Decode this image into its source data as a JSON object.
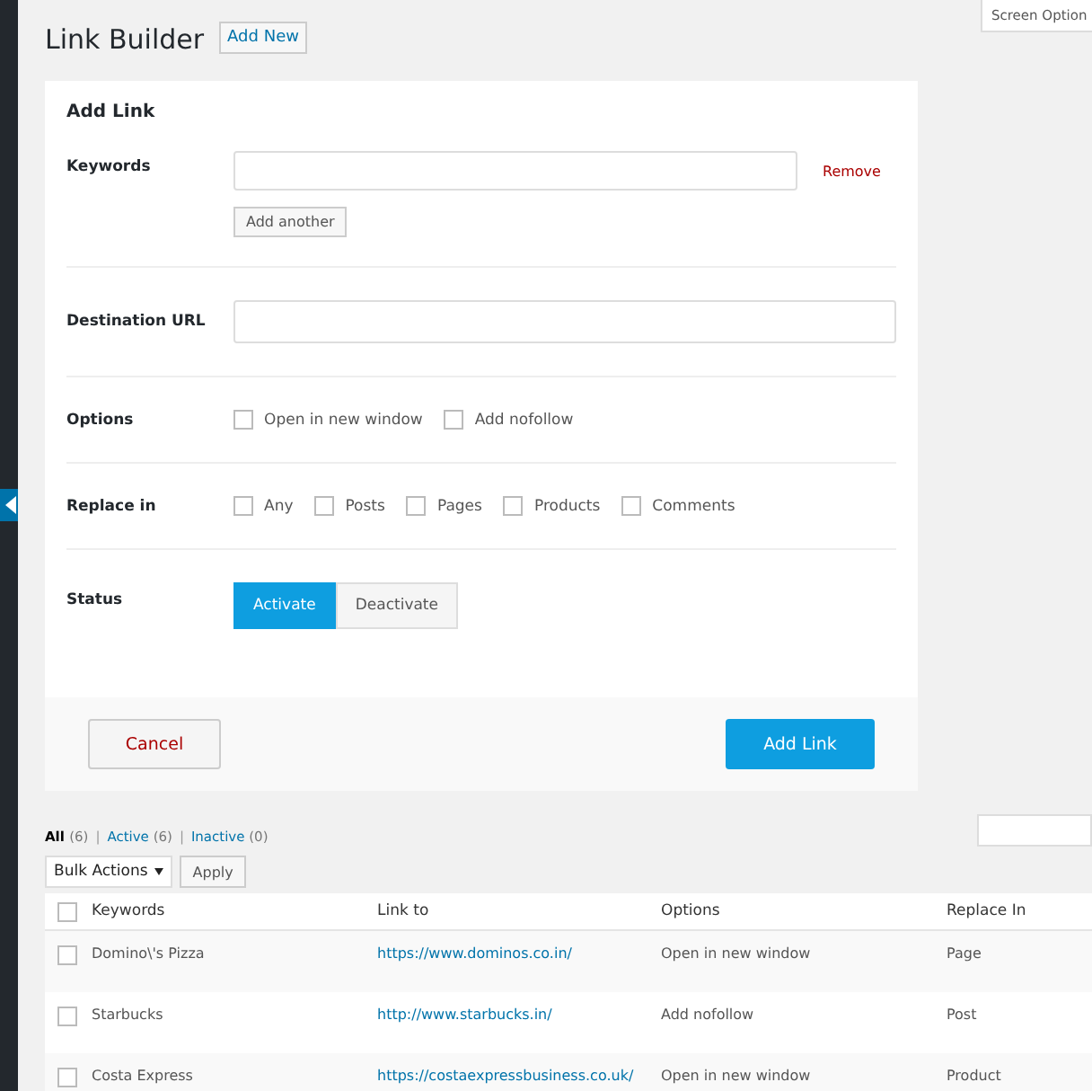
{
  "page": {
    "title": "Link Builder",
    "add_new": "Add New",
    "screen_options": "Screen Option"
  },
  "form": {
    "title": "Add Link",
    "keywords": {
      "label": "Keywords",
      "remove": "Remove",
      "add_another": "Add another"
    },
    "destination": {
      "label": "Destination URL"
    },
    "options": {
      "label": "Options",
      "items": [
        {
          "label": "Open in new window",
          "checked": false
        },
        {
          "label": "Add nofollow",
          "checked": false
        }
      ]
    },
    "replace_in": {
      "label": "Replace in",
      "items": [
        {
          "label": "Any",
          "checked": false
        },
        {
          "label": "Posts",
          "checked": false
        },
        {
          "label": "Pages",
          "checked": false
        },
        {
          "label": "Products",
          "checked": false
        },
        {
          "label": "Comments",
          "checked": false
        }
      ]
    },
    "status": {
      "label": "Status",
      "items": [
        {
          "label": "Activate",
          "selected": true
        },
        {
          "label": "Deactivate",
          "selected": false
        }
      ]
    },
    "cancel": "Cancel",
    "submit": "Add Link"
  },
  "filters": [
    {
      "label": "All",
      "count": "(6)",
      "selected": true
    },
    {
      "separator": "|",
      "label": "Active",
      "count": "(6)",
      "selected": false
    },
    {
      "separator": "|",
      "label": "Inactive",
      "count": "(0)",
      "selected": false
    }
  ],
  "bulk": {
    "select": "Bulk Actions",
    "apply": "Apply"
  },
  "table": {
    "select_all_checked": false,
    "columns": [
      "Keywords",
      "Link to",
      "Options",
      "Replace In"
    ],
    "rows": [
      {
        "checked": false,
        "cells": [
          "Domino\\'s Pizza",
          "https://www.dominos.co.in/",
          "Open in new window",
          "Page"
        ]
      },
      {
        "checked": false,
        "cells": [
          "Starbucks",
          "http://www.starbucks.in/",
          "Add nofollow",
          "Post"
        ]
      },
      {
        "checked": false,
        "cells": [
          "Costa Express",
          "https://costaexpressbusiness.co.uk/",
          "Open in new window",
          "Product"
        ]
      }
    ]
  }
}
